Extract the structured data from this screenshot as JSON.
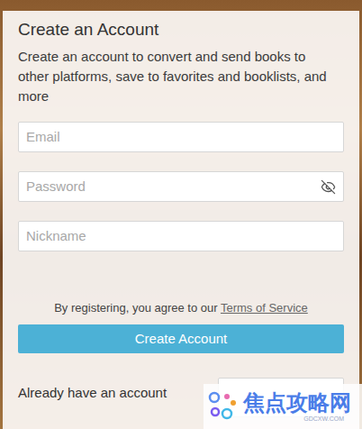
{
  "dialog": {
    "title": "Create an Account",
    "description": "Create an account to convert and send books to other platforms, save to favorites and booklists, and more"
  },
  "fields": [
    {
      "placeholder": "Email",
      "kind": "text"
    },
    {
      "placeholder": "Password",
      "kind": "password"
    },
    {
      "placeholder": "Nickname",
      "kind": "text"
    }
  ],
  "terms": {
    "text": "By registering, you agree to our ",
    "link": "Terms of Service"
  },
  "submit": "Create Account",
  "footer": {
    "text": "Already have an account"
  },
  "watermark": {
    "title": "焦点攻略网",
    "subtitle": "GDCXW.COM"
  }
}
